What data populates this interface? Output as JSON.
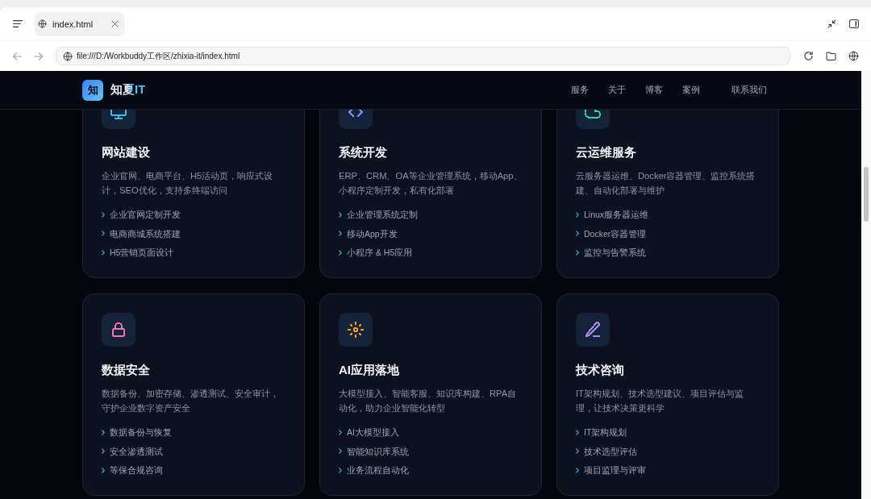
{
  "browser": {
    "tabs": [
      {
        "label": "index.html",
        "selected": true
      }
    ],
    "history_buttons": [
      {
        "kind": "back",
        "disabled": true
      },
      {
        "kind": "forward",
        "disabled": true
      }
    ],
    "address": {
      "value": "file:///D:/Workbuddy工作区/zhixia-it/index.html"
    }
  },
  "site_header": {
    "logo_mark": "知",
    "brand": "知夏IT",
    "nav": [
      {
        "label": "服务",
        "kind": "link"
      },
      {
        "label": "关于",
        "kind": "link"
      },
      {
        "label": "博客",
        "kind": "link"
      },
      {
        "label": "案例",
        "kind": "link"
      },
      {
        "label": "联系我们",
        "kind": "button"
      }
    ]
  },
  "services": [
    {
      "title": "网站建设",
      "description": "企业官网、电商平台、H5活动页，响应式设计，SEO优化，支持多终端访问",
      "features": [
        "企业官网定制开发",
        "电商商城系统搭建",
        "H5营销页面设计"
      ],
      "color": "#38bdf8"
    },
    {
      "title": "系统开发",
      "description": "ERP、CRM、OA等企业管理系统，移动App、小程序定制开发，私有化部署",
      "features": [
        "企业管理系统定制",
        "移动App开发",
        "小程序 & H5应用"
      ],
      "color": "#818cf8"
    },
    {
      "title": "云运维服务",
      "description": "云服务器运维、Docker容器管理、监控系统搭建、自动化部署与维护",
      "features": [
        "Linux服务器运维",
        "Docker容器管理",
        "监控与告警系统"
      ],
      "color": "#34d399"
    },
    {
      "title": "数据安全",
      "description": "数据备份、加密存储、渗透测试、安全审计，守护企业数字资产安全",
      "features": [
        "数据备份与恢复",
        "安全渗透测试",
        "等保合规咨询"
      ],
      "color": "#f472b6"
    },
    {
      "title": "AI应用落地",
      "description": "大模型接入、智能客服、知识库构建、RPA自动化，助力企业智能化转型",
      "features": [
        "AI大模型接入",
        "智能知识库系统",
        "业务流程自动化"
      ],
      "color": "#f59e0b"
    },
    {
      "title": "技术咨询",
      "description": "IT架构规划、技术选型建议、项目评估与监理，让技术决策更科学",
      "features": [
        "IT架构规划",
        "技术选型评估",
        "项目监理与评审"
      ],
      "color": "#a78bfa"
    }
  ]
}
